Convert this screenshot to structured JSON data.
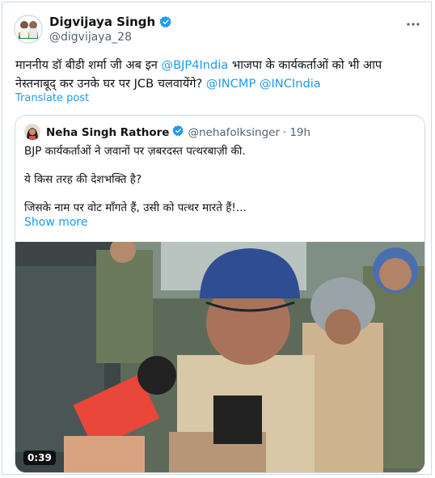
{
  "author": {
    "name": "Digvijaya Singh",
    "handle": "@digvijaya_28"
  },
  "tweet": {
    "line1_prefix": "माननीय डॉ बीडी शर्मा जी अब इन ",
    "mention1": "@BJP4India",
    "line1_suffix": " भाजपा के कार्यकर्ताओं को भी आप",
    "line2_prefix": "नेस्तनाबूद् कर उनके घर पर JCB चलवायेंगे? ",
    "mention2": "@INCMP",
    "mention3": "@INCIndia",
    "translate_label": "Translate post"
  },
  "quoted": {
    "name": "Neha Singh Rathore",
    "handle": "@nehafolksinger",
    "separator": "·",
    "time": "19h",
    "lines": [
      "BJP कार्यकर्ताओं ने जवानों पर ज़बरदस्त पत्थरबाज़ी की.",
      "ये किस तरह की देशभक्ति है?",
      "जिसके नाम पर वोट माँगते हैं, उसी को पत्थर मारते हैं!..."
    ],
    "show_more": "Show more",
    "video_duration": "0:39"
  },
  "colors": {
    "accent": "#1d9bf0",
    "muted": "#536471",
    "border": "#cfd9de"
  },
  "icons": [
    "verified-badge-icon",
    "more-options-icon"
  ]
}
